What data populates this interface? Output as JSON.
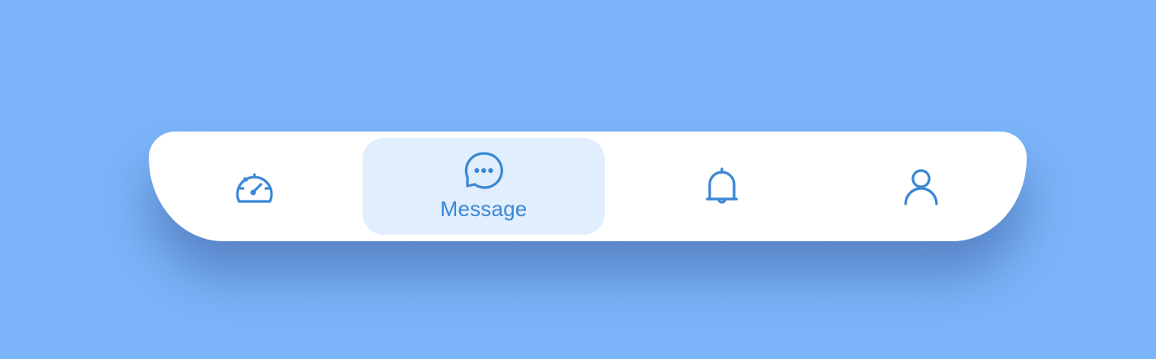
{
  "tab_bar": {
    "accent_color": "#3b87d6",
    "active_background": "#e1eefd",
    "background_color": "#7bb4f9",
    "active_tab": "message",
    "tabs": [
      {
        "id": "dashboard",
        "icon": "speedometer-icon",
        "label": ""
      },
      {
        "id": "message",
        "icon": "chat-bubble-icon",
        "label": "Message"
      },
      {
        "id": "notifications",
        "icon": "bell-icon",
        "label": ""
      },
      {
        "id": "profile",
        "icon": "user-icon",
        "label": ""
      }
    ]
  }
}
